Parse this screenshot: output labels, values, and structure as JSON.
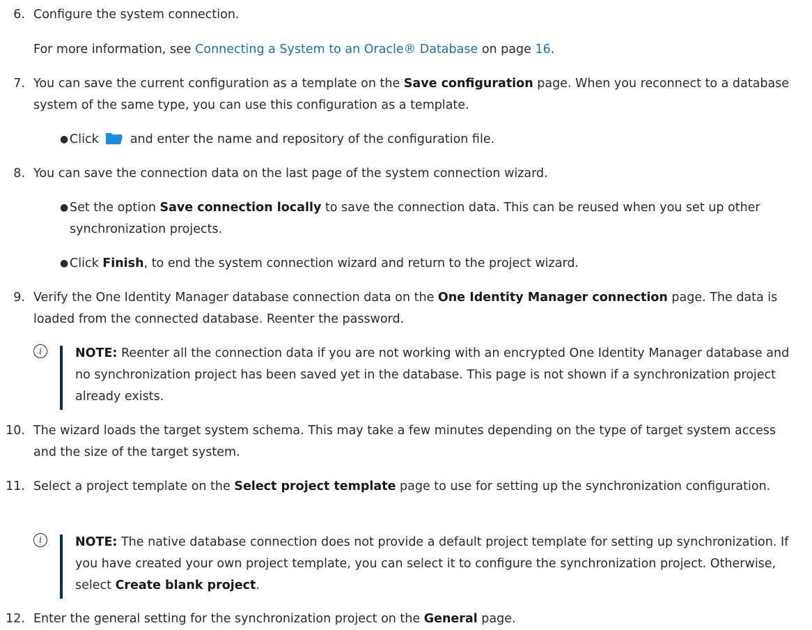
{
  "steps": {
    "s6": {
      "num": "6.",
      "text": "Configure the system connection.",
      "para_pre": "For more information, see ",
      "para_link": "Connecting a System to an Oracle® Database",
      "para_mid": " on page ",
      "para_page": "16",
      "para_post": "."
    },
    "s7": {
      "num": "7.",
      "pre": "You can save the current configuration as a template on the ",
      "bold": "Save configuration",
      "post": " page. When you reconnect to a database system of the same type, you can use this configuration as a template.",
      "bullet_pre": "Click ",
      "bullet_post": " and enter the name and repository of the configuration file."
    },
    "s8": {
      "num": "8.",
      "text": "You can save the connection data on the last page of the system connection wizard.",
      "b1_pre": "Set the option ",
      "b1_bold": "Save connection locally",
      "b1_post": " to save the connection data. This can be reused when you set up other synchronization projects.",
      "b2_pre": "Click ",
      "b2_bold": "Finish",
      "b2_post": ", to end the system connection wizard and return to the project wizard."
    },
    "s9": {
      "num": "9.",
      "pre": "Verify the One Identity Manager database connection data on the ",
      "bold": "One Identity Manager connection",
      "post": " page. The data is loaded from the connected database. Reenter the password.",
      "note_label": "NOTE:",
      "note_text": " Reenter all the connection data if you are not working with an encrypted One Identity Manager database and no synchronization project has been saved yet in the database. This page is not shown if a synchronization project already exists."
    },
    "s10": {
      "num": "10.",
      "text": "The wizard loads the target system schema. This may take a few minutes depending on the type of target system access and the size of the target system."
    },
    "s11": {
      "num": "11.",
      "pre": "Select a project template on the ",
      "bold": "Select project template",
      "post": " page to use for setting up the synchronization configuration.",
      "note_label": "NOTE:",
      "note_pre": " The native database connection does not provide a default project template for setting up synchronization. If you have created your own project template, you can select it to configure the synchronization project. Otherwise, select ",
      "note_bold": "Create blank project",
      "note_post": "."
    },
    "s12": {
      "num": "12.",
      "pre": "Enter the general setting for the synchronization project on the ",
      "bold": "General",
      "post": " page."
    }
  },
  "icons": {
    "info": "info-icon",
    "folder": "folder-open-icon",
    "bullet": "bullet-dot"
  },
  "colors": {
    "link": "#1e6fb5",
    "note_bar": "#0f2d52",
    "folder": "#1a8fe0"
  }
}
